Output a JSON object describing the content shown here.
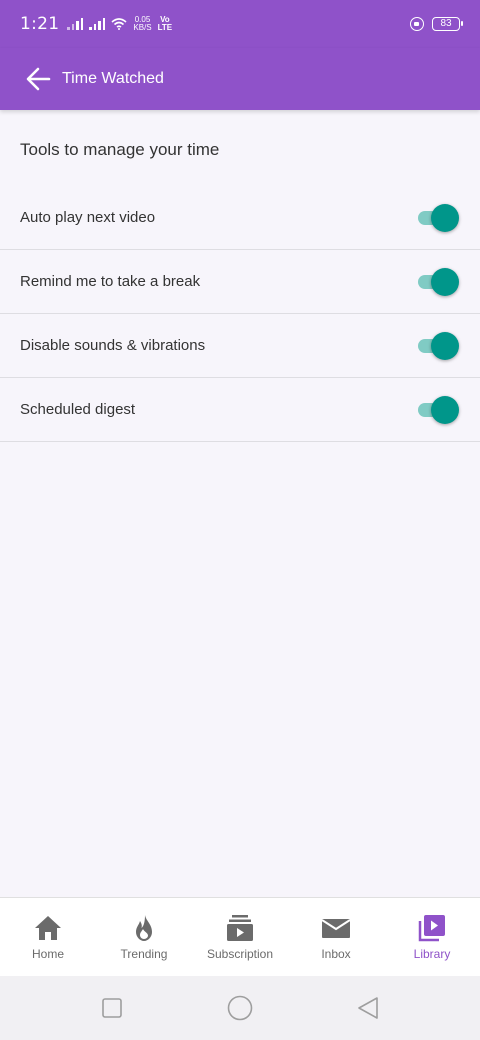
{
  "status_bar": {
    "time": "1:21",
    "speed_value": "0.05",
    "speed_unit": "KB/S",
    "volte_top": "Vo",
    "volte_bottom": "LTE",
    "battery": "83"
  },
  "app_bar": {
    "title": "Time Watched"
  },
  "section": {
    "title": "Tools to manage your time"
  },
  "settings": [
    {
      "label": "Auto play next video",
      "enabled": true
    },
    {
      "label": "Remind me to take a break",
      "enabled": true
    },
    {
      "label": "Disable sounds & vibrations",
      "enabled": true
    },
    {
      "label": "Scheduled digest",
      "enabled": true
    }
  ],
  "bottom_nav": {
    "items": [
      {
        "label": "Home",
        "icon": "home-icon"
      },
      {
        "label": "Trending",
        "icon": "flame-icon"
      },
      {
        "label": "Subscription",
        "icon": "subscription-icon"
      },
      {
        "label": "Inbox",
        "icon": "mail-icon"
      },
      {
        "label": "Library",
        "icon": "library-icon",
        "active": true
      }
    ]
  },
  "colors": {
    "accent": "#8f52c9",
    "toggle_on": "#00968a",
    "toggle_track": "#80cbc4"
  }
}
